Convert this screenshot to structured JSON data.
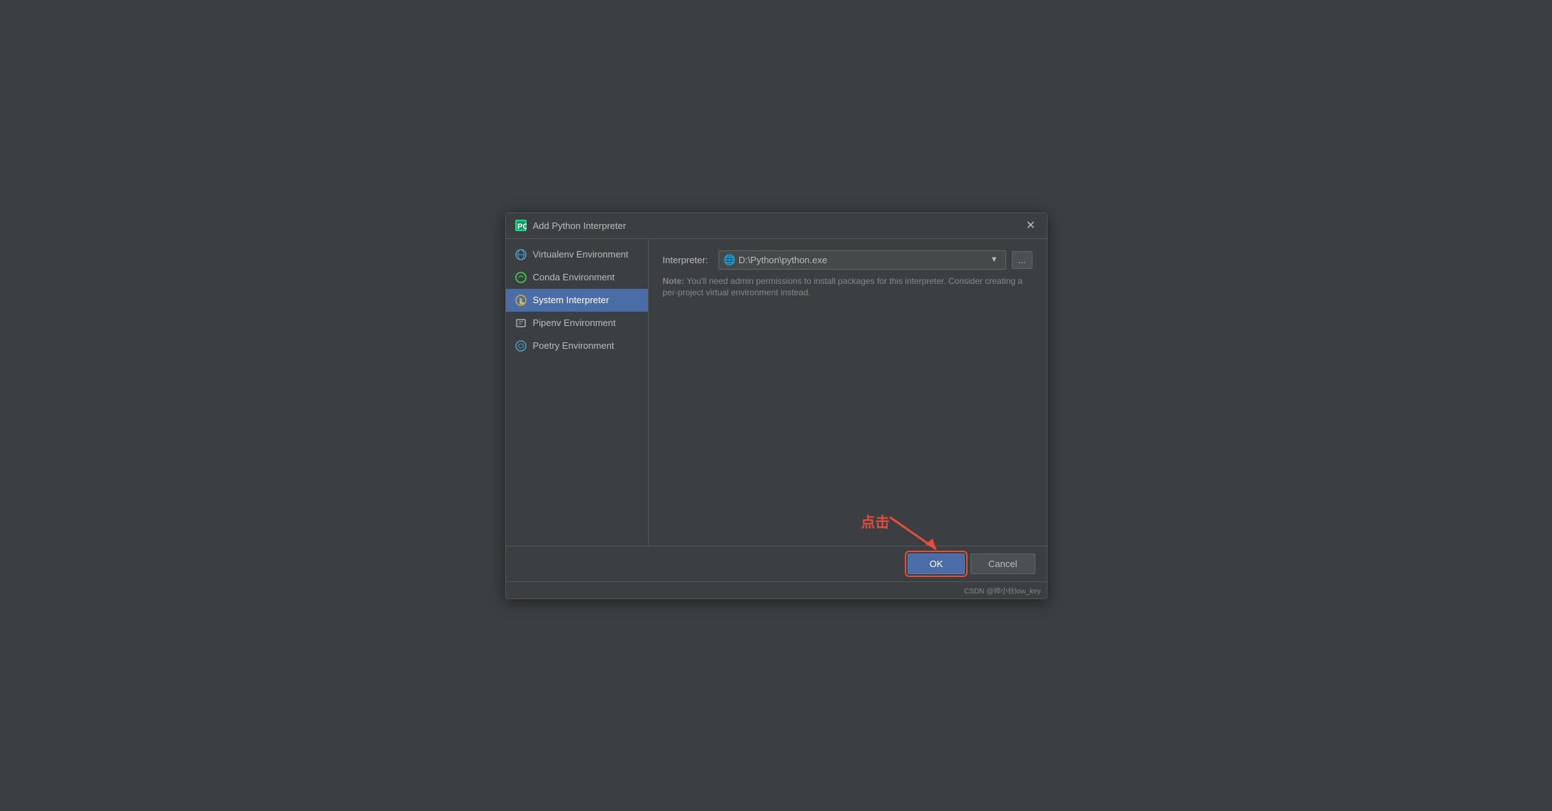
{
  "dialog": {
    "title": "Add Python Interpreter",
    "icon": "pycharm-icon"
  },
  "sidebar": {
    "items": [
      {
        "id": "virtualenv",
        "label": "Virtualenv Environment",
        "icon": "virtualenv-icon",
        "active": false
      },
      {
        "id": "conda",
        "label": "Conda Environment",
        "icon": "conda-icon",
        "active": false
      },
      {
        "id": "system",
        "label": "System Interpreter",
        "icon": "system-icon",
        "active": true
      },
      {
        "id": "pipenv",
        "label": "Pipenv Environment",
        "icon": "pipenv-icon",
        "active": false
      },
      {
        "id": "poetry",
        "label": "Poetry Environment",
        "icon": "poetry-icon",
        "active": false
      }
    ]
  },
  "main": {
    "interpreter_label": "Interpreter:",
    "interpreter_value": "D:\\Python\\python.exe",
    "browse_label": "...",
    "note_label": "Note:",
    "note_text": " You'll need admin permissions to install packages for this interpreter. Consider creating a per-project virtual environment instead."
  },
  "footer": {
    "ok_label": "OK",
    "cancel_label": "Cancel",
    "watermark": "CSDN @帅小伙low_key",
    "annotation_click": "点击"
  }
}
